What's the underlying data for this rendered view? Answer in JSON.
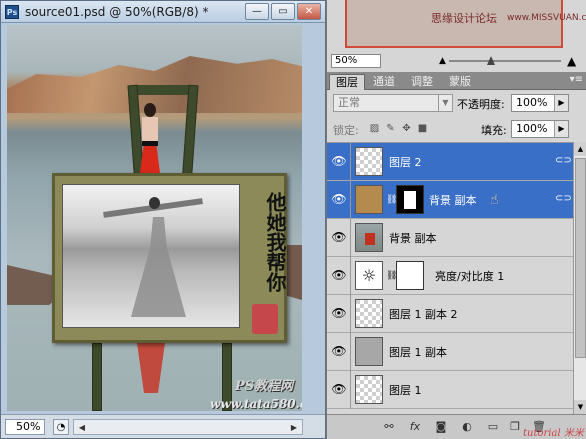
{
  "document": {
    "app_badge": "Ps",
    "title": "source01.psd @ 50%(RGB/8) *",
    "zoom": "50%",
    "buttons": {
      "minimize": "—",
      "restore": "▭",
      "close": "✕"
    },
    "watermark_line1": "PS教程网",
    "watermark_line2": "www.tata580.com",
    "calligraphy": "他她我帮你"
  },
  "navigator": {
    "watermark": "思缘设计论坛",
    "watermark_url": "www.MISSVUAN.com",
    "zoom": "50%"
  },
  "tabs": [
    {
      "label": "图层",
      "active": true
    },
    {
      "label": "通道",
      "active": false
    },
    {
      "label": "调整",
      "active": false
    },
    {
      "label": "蒙版",
      "active": false
    }
  ],
  "blend": {
    "mode": "正常",
    "opacity_label": "不透明度:",
    "opacity": "100%",
    "lock_label": "锁定:",
    "fill_label": "填充:",
    "fill": "100%"
  },
  "layers": [
    {
      "name": "图层 2",
      "selected": true,
      "thumb": "checker",
      "mask": null,
      "link_icon": true
    },
    {
      "name": "背景 副本",
      "selected": true,
      "thumb": "easel",
      "mask": "bw",
      "link_icon": true
    },
    {
      "name": "背景 副本",
      "selected": false,
      "thumb": "bg",
      "mask": null,
      "link_icon": false
    },
    {
      "name": "亮度/对比度 1",
      "selected": false,
      "thumb": "adj",
      "mask": "white",
      "link_icon": false
    },
    {
      "name": "图层 1 副本 2",
      "selected": false,
      "thumb": "checker",
      "mask": null,
      "link_icon": false
    },
    {
      "name": "图层 1 副本",
      "selected": false,
      "thumb": "dark",
      "mask": null,
      "link_icon": false
    },
    {
      "name": "图层 1",
      "selected": false,
      "thumb": "checker",
      "mask": null,
      "link_icon": false
    }
  ],
  "bottom_watermark": "tutorial 米米"
}
